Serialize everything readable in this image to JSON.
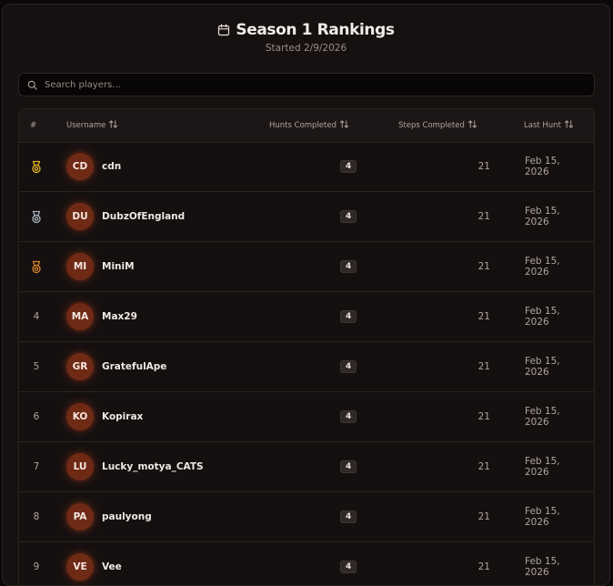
{
  "header": {
    "title": "Season 1 Rankings",
    "subtitle": "Started 2/9/2026",
    "icon": "calendar-icon"
  },
  "search": {
    "placeholder": "Search players...",
    "value": "",
    "icon": "search-icon"
  },
  "table": {
    "columns": {
      "rank": "#",
      "username": "Username",
      "hunts": "Hunts Completed",
      "steps": "Steps Completed",
      "last_hunt": "Last Hunt"
    },
    "rows": [
      {
        "rank": "",
        "medal": "gold",
        "initials": "CD",
        "username": "cdn",
        "hunts": "4",
        "steps": "21",
        "last_hunt": "Feb 15, 2026"
      },
      {
        "rank": "",
        "medal": "silver",
        "initials": "DU",
        "username": "DubzOfEngland",
        "hunts": "4",
        "steps": "21",
        "last_hunt": "Feb 15, 2026"
      },
      {
        "rank": "",
        "medal": "bronze",
        "initials": "MI",
        "username": "MiniM",
        "hunts": "4",
        "steps": "21",
        "last_hunt": "Feb 15, 2026"
      },
      {
        "rank": "4",
        "medal": "",
        "initials": "MA",
        "username": "Max29",
        "hunts": "4",
        "steps": "21",
        "last_hunt": "Feb 15, 2026"
      },
      {
        "rank": "5",
        "medal": "",
        "initials": "GR",
        "username": "GratefulApe",
        "hunts": "4",
        "steps": "21",
        "last_hunt": "Feb 15, 2026"
      },
      {
        "rank": "6",
        "medal": "",
        "initials": "KO",
        "username": "Kopirax",
        "hunts": "4",
        "steps": "21",
        "last_hunt": "Feb 15, 2026"
      },
      {
        "rank": "7",
        "medal": "",
        "initials": "LU",
        "username": "Lucky_motya_CATS",
        "hunts": "4",
        "steps": "21",
        "last_hunt": "Feb 15, 2026"
      },
      {
        "rank": "8",
        "medal": "",
        "initials": "PA",
        "username": "paulyong",
        "hunts": "4",
        "steps": "21",
        "last_hunt": "Feb 15, 2026"
      },
      {
        "rank": "9",
        "medal": "",
        "initials": "VE",
        "username": "Vee",
        "hunts": "4",
        "steps": "21",
        "last_hunt": "Feb 15, 2026"
      }
    ]
  },
  "colors": {
    "gold": "#e0b020",
    "silver": "#a8b0bc",
    "bronze": "#d8822a",
    "avatar": "#6f2a16"
  }
}
